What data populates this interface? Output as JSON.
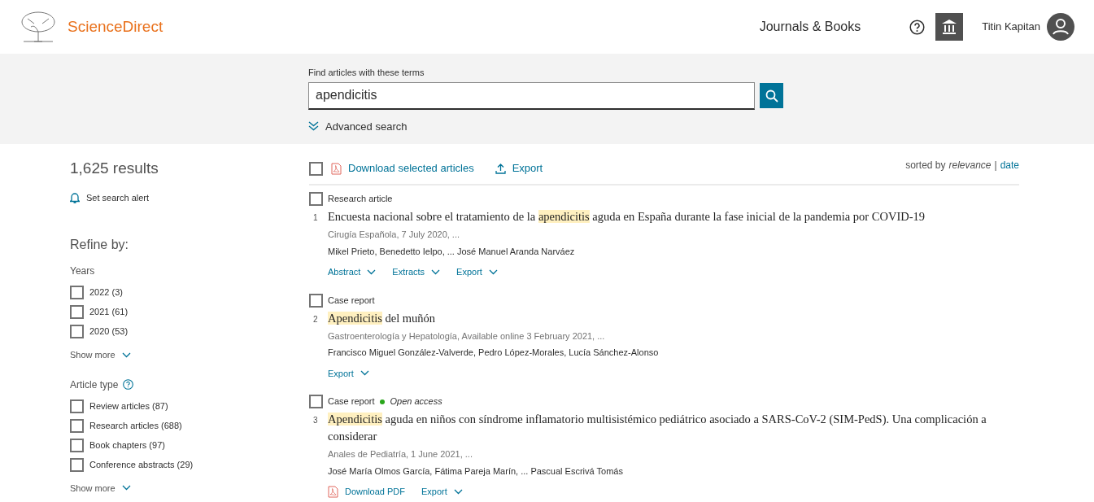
{
  "header": {
    "brand": "ScienceDirect",
    "nav": "Journals & Books",
    "user": "Titin Kapitan"
  },
  "search": {
    "label": "Find articles with these terms",
    "value": "apendicitis",
    "advanced": "Advanced search"
  },
  "sidebar": {
    "count": "1,625 results",
    "alert": "Set search alert",
    "refine": "Refine by:",
    "groups": [
      {
        "title": "Years",
        "help": false,
        "options": [
          {
            "label": "2022 (3)",
            "checked": false
          },
          {
            "label": "2021 (61)",
            "checked": false
          },
          {
            "label": "2020 (53)",
            "checked": false
          }
        ],
        "more": "Show more"
      },
      {
        "title": "Article type",
        "help": true,
        "options": [
          {
            "label": "Review articles (87)",
            "checked": false
          },
          {
            "label": "Research articles (688)",
            "checked": false
          },
          {
            "label": "Book chapters (97)",
            "checked": false
          },
          {
            "label": "Conference abstracts (29)",
            "checked": false
          }
        ],
        "more": "Show more"
      }
    ]
  },
  "toolbar": {
    "select_all": false,
    "download": "Download selected articles",
    "export": "Export",
    "sorted_by": "sorted by",
    "separator": "|",
    "sort_options": [
      {
        "label": "relevance",
        "selected": true
      },
      {
        "label": "date",
        "selected": false
      }
    ]
  },
  "results": [
    {
      "number": "1",
      "type": "Research article",
      "checked": false,
      "title": [
        {
          "text": "Encuesta nacional sobre el tratamiento de la ",
          "highlight": false
        },
        {
          "text": "apendicitis",
          "highlight": true
        },
        {
          "text": " aguda en España durante la fase inicial de la pandemia por COVID-19",
          "highlight": false
        }
      ],
      "source": "Cirugía Española, 7 July 2020, ...",
      "authors": "Mikel Prieto, Benedetto Ielpo, ... José Manuel Aranda Narváez",
      "actions": [
        {
          "kind": "dropdown",
          "label": "Abstract"
        },
        {
          "kind": "dropdown",
          "label": "Extracts"
        },
        {
          "kind": "dropdown",
          "label": "Export"
        }
      ]
    },
    {
      "number": "2",
      "type": "Case report",
      "checked": false,
      "title": [
        {
          "text": "Apendicitis",
          "highlight": true
        },
        {
          "text": " del muñón",
          "highlight": false
        }
      ],
      "source": "Gastroenterología y Hepatología, Available online 3 February 2021, ...",
      "authors": "Francisco Miguel González-Valverde, Pedro López-Morales, Lucía Sánchez-Alonso",
      "actions": [
        {
          "kind": "dropdown",
          "label": "Export"
        }
      ]
    },
    {
      "number": "3",
      "type": "Case report",
      "open_access": "Open access",
      "checked": false,
      "title": [
        {
          "text": "Apendicitis",
          "highlight": true
        },
        {
          "text": " aguda en niños con síndrome inflamatorio multisistémico pediátrico asociado a SARS-CoV-2 (SIM-PedS). Una complicación a considerar",
          "highlight": false
        }
      ],
      "source": "Anales de Pediatría, 1 June 2021, ...",
      "authors": "José María Olmos García, Fátima Pareja Marín, ... Pascual Escrivá Tomás",
      "actions": [
        {
          "kind": "pdf",
          "label": "Download PDF"
        },
        {
          "kind": "dropdown",
          "label": "Export"
        }
      ]
    }
  ]
}
